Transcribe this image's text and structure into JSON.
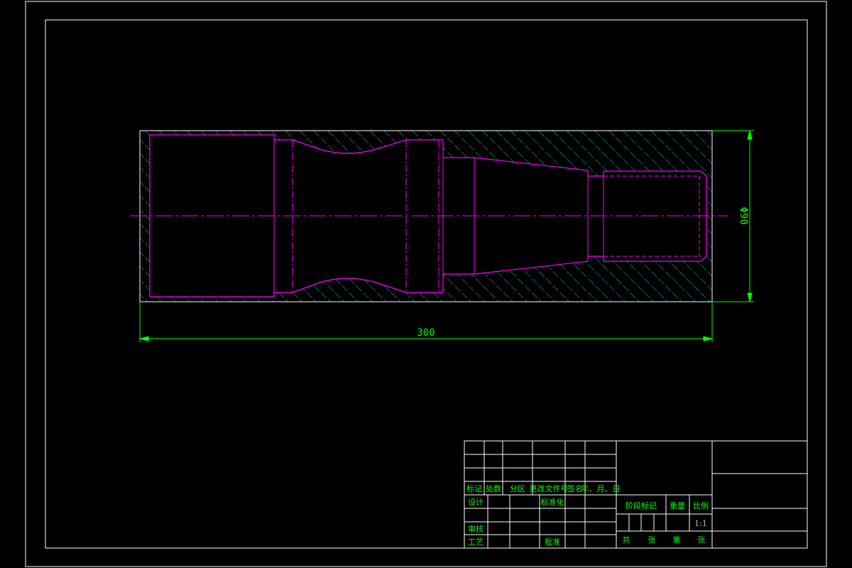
{
  "colors": {
    "background": "#000000",
    "frame": "#ffffff",
    "part_outline": "#ff00ff",
    "hatch": "#00ffff",
    "dimension": "#00ff00",
    "centerline": "#ff00ff"
  },
  "drawing": {
    "dimension_length": "300",
    "dimension_diameter": "Φ90"
  },
  "title_block": {
    "mark": "标记",
    "count": "处数",
    "zone": "分区",
    "change_doc": "更改文件号",
    "signature": "签名",
    "date": "年、月、日",
    "design": "设计",
    "standardize": "标准化",
    "stage_mark": "阶段标记",
    "weight": "重量",
    "scale_label": "比例",
    "scale_value": "1:1",
    "review": "审核",
    "process": "工艺",
    "approve": "批准",
    "total": "共",
    "sheet1": "张",
    "page": "第",
    "sheet2": "张"
  }
}
